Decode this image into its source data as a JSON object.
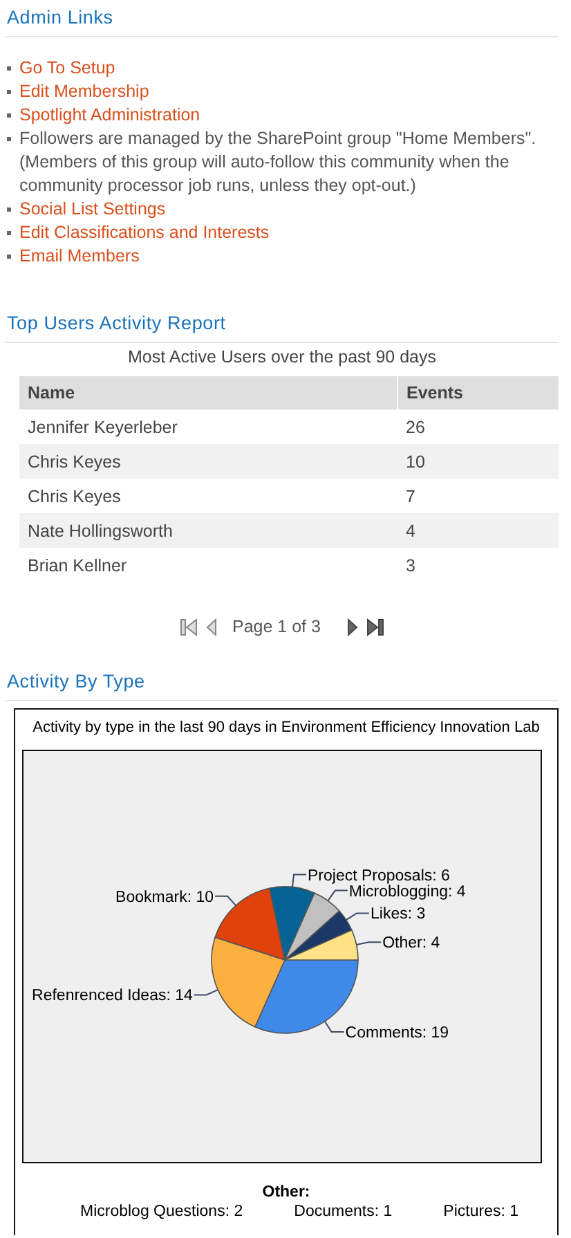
{
  "admin_links": {
    "title": "Admin Links",
    "items": [
      {
        "kind": "link",
        "text": "Go To Setup"
      },
      {
        "kind": "link",
        "text": "Edit Membership"
      },
      {
        "kind": "link",
        "text": "Spotlight Administration"
      },
      {
        "kind": "note",
        "text": "Followers are managed by the SharePoint group \"Home Members\". (Members of this group will auto-follow this community when the community processor job runs, unless they opt-out.)"
      },
      {
        "kind": "link",
        "text": "Social List Settings"
      },
      {
        "kind": "link",
        "text": "Edit Classifications and Interests"
      },
      {
        "kind": "link",
        "text": "Email Members"
      }
    ]
  },
  "top_users_report": {
    "title": "Top Users Activity Report",
    "caption": "Most Active Users over the past 90 days",
    "columns": [
      "Name",
      "Events"
    ],
    "rows": [
      {
        "name": "Jennifer Keyerleber",
        "events": "26"
      },
      {
        "name": "Chris Keyes",
        "events": "10"
      },
      {
        "name": "Chris Keyes",
        "events": "7"
      },
      {
        "name": "Nate Hollingsworth",
        "events": "4"
      },
      {
        "name": "Brian Kellner",
        "events": "3"
      }
    ],
    "pager": "Page 1 of 3"
  },
  "activity_by_type": {
    "title": "Activity By Type",
    "chart_data": {
      "type": "pie",
      "title": "Activity by type in the last 90 days in Environment Efficiency Innovation Lab",
      "values": [
        19,
        14,
        10,
        6,
        4,
        3,
        4
      ],
      "colors": [
        "#3f8ae8",
        "#fbb040",
        "#e0420e",
        "#066494",
        "#c0c0c0",
        "#1b3866",
        "#ffe285"
      ],
      "value_labels": [
        "Comments: 19",
        "Refenrenced Ideas: 14",
        "Bookmark: 10",
        "Project Proposals: 6",
        "Microblogging: 4",
        "Likes: 3",
        "Other: 4"
      ]
    },
    "other": {
      "title": "Other:",
      "items": [
        {
          "label": "Microblog Questions: 2"
        },
        {
          "label": "Documents: 1"
        },
        {
          "label": "Pictures: 1"
        }
      ]
    }
  }
}
